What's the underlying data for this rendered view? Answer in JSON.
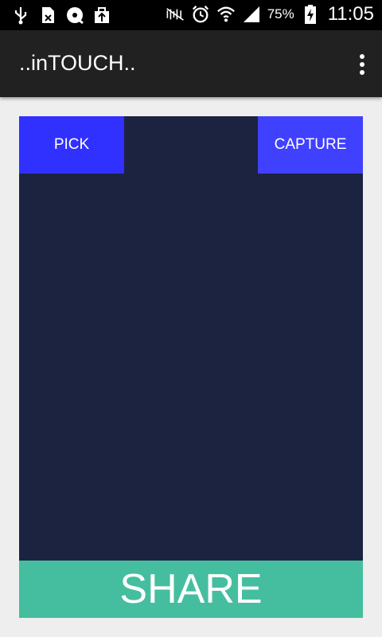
{
  "status_bar": {
    "left_icons": [
      "usb-icon",
      "sim-off-icon",
      "sync-disk-icon",
      "bag-upload-icon"
    ],
    "right_icons": [
      "nfc-mute-icon",
      "alarm-icon",
      "wifi-icon",
      "signal-icon",
      "battery-charging-icon"
    ],
    "battery_percent": "75%",
    "time": "11:05"
  },
  "app_bar": {
    "title": "..inTOUCH..",
    "overflow_icon": "more-vert-icon"
  },
  "main": {
    "pick_label": "PICK",
    "capture_label": "CAPTURE",
    "share_label": "SHARE"
  },
  "colors": {
    "canvas": "#1c2340",
    "pick": "#3030ff",
    "capture": "#4040ff",
    "share": "#45be9f",
    "app_bar": "#212121"
  }
}
